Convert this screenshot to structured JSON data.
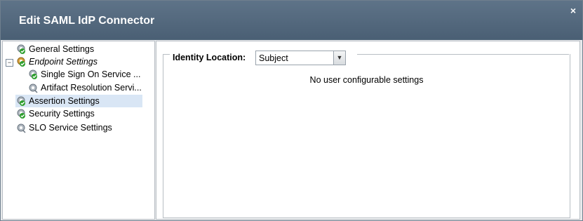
{
  "window": {
    "title": "Edit SAML IdP Connector",
    "close_glyph": "×"
  },
  "tree": {
    "items": [
      {
        "label": "General Settings",
        "icon": "gear-check-icon"
      },
      {
        "label": "Endpoint Settings",
        "icon": "gear-check-warning-icon",
        "italic": true,
        "expanded": true
      },
      {
        "label": "Single Sign On Service ...",
        "icon": "gear-check-icon"
      },
      {
        "label": "Artifact Resolution Servi...",
        "icon": "gear-icon"
      },
      {
        "label": "Assertion Settings",
        "icon": "gear-check-icon",
        "selected": true
      },
      {
        "label": "Security Settings",
        "icon": "gear-check-icon"
      },
      {
        "label": "SLO Service Settings",
        "icon": "gear-icon"
      }
    ],
    "expander_glyph": "−"
  },
  "form": {
    "identity_location_label": "Identity Location:",
    "identity_location_value": "Subject",
    "dropdown_glyph": "▼",
    "message": "No user configurable settings"
  },
  "colors": {
    "titlebar": "#53687d",
    "selected_row": "#d9e6f5",
    "check_green": "#2e9e2e"
  }
}
